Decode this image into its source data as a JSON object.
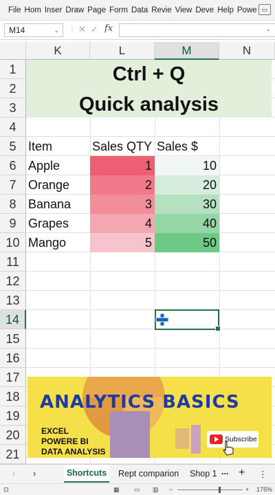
{
  "ribbon": {
    "tabs": [
      "File",
      "Hom",
      "Inser",
      "Draw",
      "Page",
      "Form",
      "Data",
      "Revie",
      "View",
      "Deve",
      "Help",
      "Powe"
    ]
  },
  "formula_bar": {
    "name_box": "M14",
    "fx_label": "fx",
    "value": ""
  },
  "columns": [
    "K",
    "L",
    "M",
    "N"
  ],
  "selected_column": "M",
  "rows": [
    "1",
    "2",
    "3",
    "4",
    "5",
    "6",
    "7",
    "8",
    "9",
    "10",
    "11",
    "12",
    "13",
    "14",
    "15",
    "16",
    "17",
    "18",
    "19",
    "20",
    "21"
  ],
  "selected_row": "14",
  "sheet": {
    "title_line1": "Ctrl + Q",
    "title_line2": "Quick analysis",
    "headers": {
      "item": "Item",
      "qty": "Sales QTY",
      "sales": "Sales $"
    },
    "data": [
      {
        "item": "Apple",
        "qty": "1",
        "sales": "10"
      },
      {
        "item": "Orange",
        "qty": "2",
        "sales": "20"
      },
      {
        "item": "Banana",
        "qty": "3",
        "sales": "30"
      },
      {
        "item": "Grapes",
        "qty": "4",
        "sales": "40"
      },
      {
        "item": "Mango",
        "qty": "5",
        "sales": "50"
      }
    ],
    "qty_scale_colors": [
      "#ef5f73",
      "#f07888",
      "#f28e9c",
      "#f4a6b2",
      "#f7c3cc"
    ],
    "sales_scale_colors": [
      "#f1f7f3",
      "#d6ecdd",
      "#b6e1c1",
      "#95d5a6",
      "#6ec985"
    ]
  },
  "banner": {
    "title": "ANALYTICS BASICS",
    "lines": [
      "EXCEL",
      "POWERE BI",
      "DATA ANALYSIS"
    ],
    "subscribe": "Subscribe"
  },
  "tabs": {
    "active": "Shortcuts",
    "others": [
      "Rept comparion",
      "Shop 1"
    ],
    "more": "...",
    "add": "+",
    "menu": "⋮"
  },
  "status": {
    "zoom": "175%"
  },
  "colors": {
    "accent": "#217346",
    "title_fill": "#e2efda",
    "banner_fill": "#f6e04a",
    "banner_text": "#1f3aa3"
  }
}
